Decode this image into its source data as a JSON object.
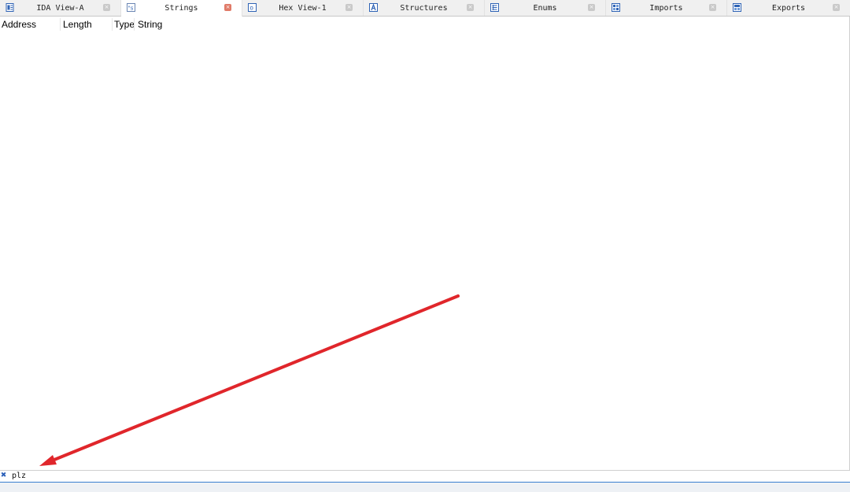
{
  "tabs": [
    {
      "label": "IDA View-A",
      "icon": "disassembly-view-icon",
      "active": false
    },
    {
      "label": "Strings",
      "icon": "strings-icon",
      "active": true
    },
    {
      "label": "Hex View-1",
      "icon": "hex-view-icon",
      "active": false
    },
    {
      "label": "Structures",
      "icon": "structures-icon",
      "active": false
    },
    {
      "label": "Enums",
      "icon": "enums-icon",
      "active": false
    },
    {
      "label": "Imports",
      "icon": "imports-icon",
      "active": false
    },
    {
      "label": "Exports",
      "icon": "exports-icon",
      "active": false
    }
  ],
  "tab_close_glyph": "×",
  "strings_window": {
    "columns": [
      "Address",
      "Length",
      "Type",
      "String"
    ],
    "rows": []
  },
  "filter": {
    "close_icon": "close-icon",
    "value": "plz"
  },
  "annotation": {
    "color": "#e0262b",
    "type": "arrow"
  },
  "colors": {
    "active_close": "#e07a68",
    "filter_border": "#3a7fd0",
    "icon_blue": "#2f63b5"
  }
}
